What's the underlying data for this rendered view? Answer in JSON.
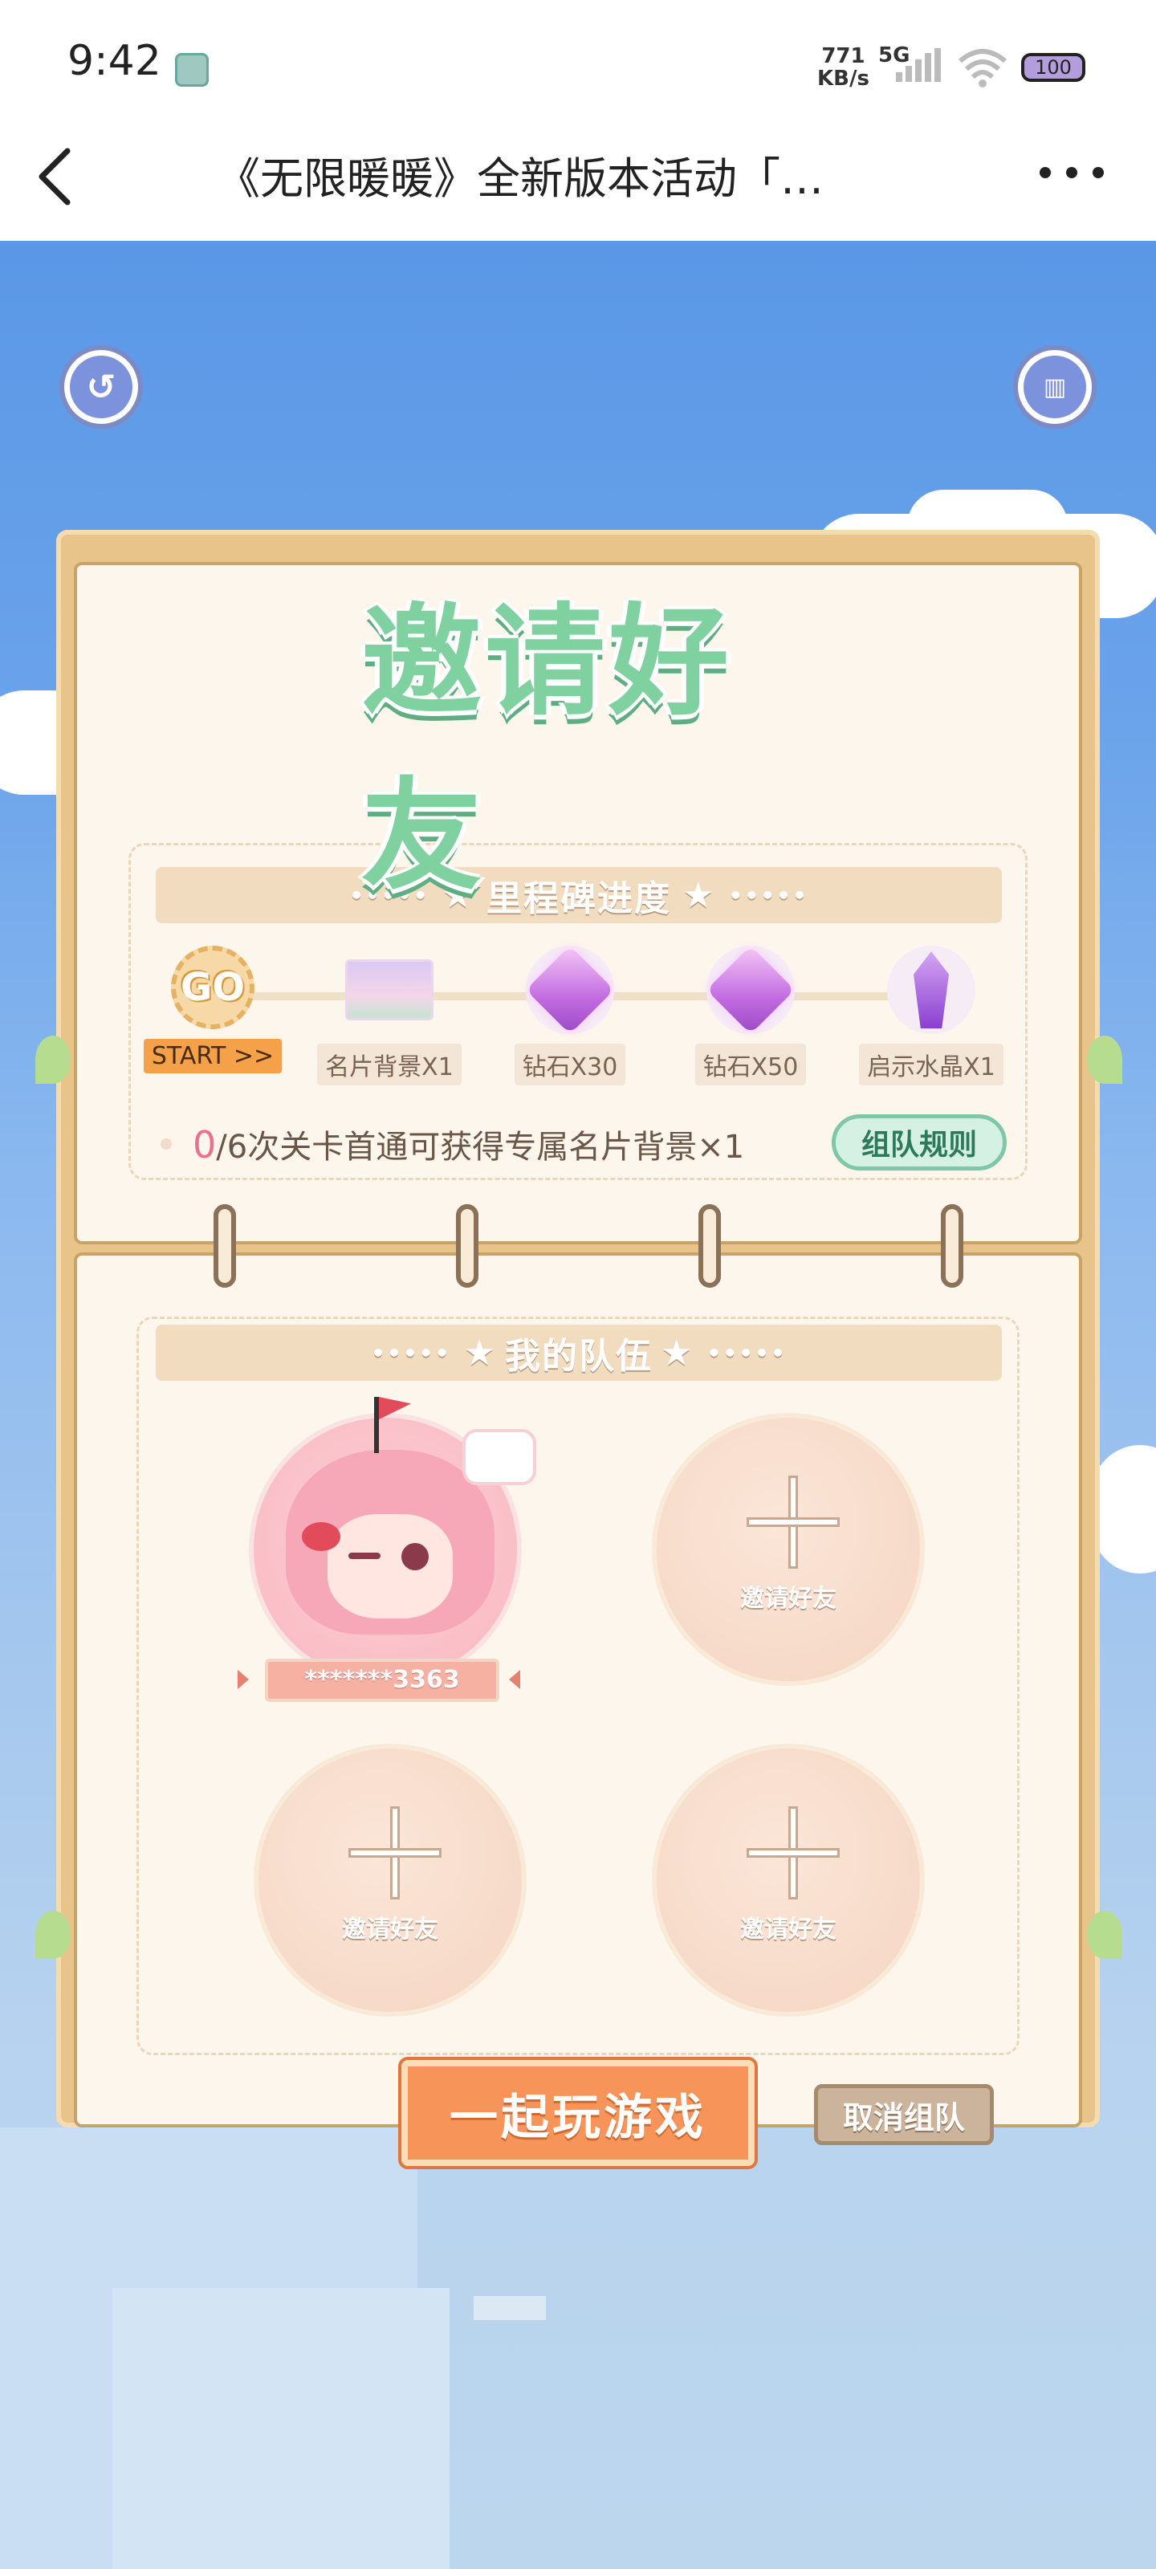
{
  "status_bar": {
    "time": "9:42",
    "net_speed_value": "771",
    "net_speed_unit": "KB/s",
    "network": "5G",
    "battery": "100"
  },
  "title_bar": {
    "title": "《无限暖暖》全新版本活动「…"
  },
  "game": {
    "heading": "邀请好友",
    "milestone_section": {
      "title": "里程碑进度",
      "milestones": [
        {
          "label": "START >>",
          "icon": "go-icon"
        },
        {
          "label": "名片背景X1",
          "icon": "card-background-icon"
        },
        {
          "label": "钻石X30",
          "icon": "diamond-icon"
        },
        {
          "label": "钻石X50",
          "icon": "diamond-icon"
        },
        {
          "label": "启示水晶X1",
          "icon": "crystal-icon"
        }
      ],
      "progress_count": "0",
      "progress_text": "/6次关卡首通可获得专属名片背景×1",
      "rules_button": "组队规则"
    },
    "team_section": {
      "title": "我的队伍",
      "member_name": "*******3363",
      "invite_label": "邀请好友"
    },
    "play_button": "一起玩游戏",
    "cancel_button": "取消组队",
    "go_text": "GO",
    "star": "★",
    "dots": "•••••"
  },
  "colors": {
    "sky": "#5a97e6",
    "panel": "#fdf6ec",
    "accent_green": "#7fd1a0",
    "accent_orange": "#f6945a"
  }
}
